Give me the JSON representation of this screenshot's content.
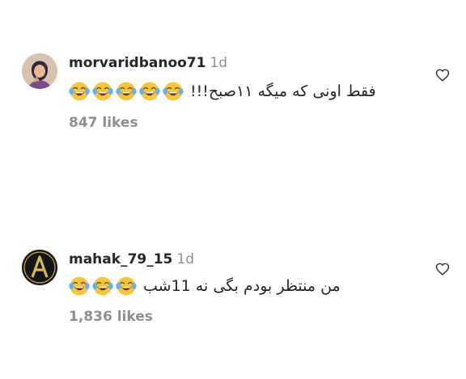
{
  "comments": [
    {
      "username": "morvaridbanoo71",
      "time": "1d",
      "emoji_count": 5,
      "text": "فقط اونی که میگه ۱۱صبح!!!",
      "likes": "847 likes",
      "avatar_icon": "profile-photo",
      "heart_icon": "heart-outline-icon"
    },
    {
      "username": "mahak_79_15",
      "time": "1d",
      "emoji_count": 3,
      "text": "من منتظر بودم بگی نه 11شب",
      "likes": "1,836 likes",
      "avatar_icon": "letter-a-avatar",
      "heart_icon": "heart-outline-icon"
    }
  ],
  "colors": {
    "text": "#262626",
    "secondary": "#8e8e8e",
    "emoji_face": "#f7c43a"
  }
}
